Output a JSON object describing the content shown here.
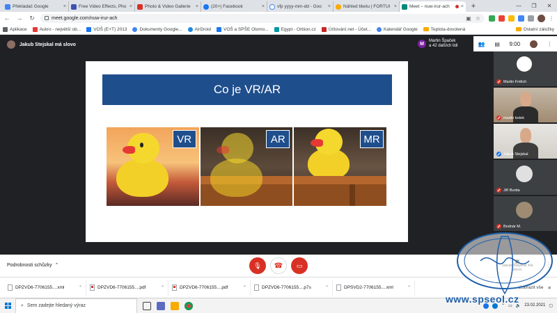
{
  "browser": {
    "tabs": [
      {
        "title": "Překladač Google",
        "color": "#4285f4"
      },
      {
        "title": "Free Video Effects, Pho",
        "color": "#3f51b5"
      },
      {
        "title": "Photo & Video Gallerie",
        "color": "#d93025"
      },
      {
        "title": "(20+) Facebook",
        "color": "#1877f2"
      },
      {
        "title": "vfp yyyy-mm-dd - Goo",
        "color": "#4285f4"
      },
      {
        "title": "Náhled tiketu | FORTUI",
        "color": "#f9ab00"
      },
      {
        "title": "Meet – nuw-irur-ach",
        "color": "#00897b",
        "active": true
      }
    ],
    "new_tab": "+",
    "url": "meet.google.com/nuw-irur-ach",
    "bookmarks": [
      {
        "label": "Aplikace",
        "color": "#5f6368"
      },
      {
        "label": "Aukro - největší ob...",
        "color": "#e53935"
      },
      {
        "label": "VOŠ (E+T) 2013",
        "color": "#1877f2"
      },
      {
        "label": "Dokumenty Google...",
        "color": "#4285f4"
      },
      {
        "label": "AirDroid",
        "color": "#1e88e5"
      },
      {
        "label": "VOŠ a SPŠE Olomo...",
        "color": "#1877f2"
      },
      {
        "label": "Egypt - Orbion.cz",
        "color": "#0097a7"
      },
      {
        "label": "Účtování.net - Účet...",
        "color": "#c62828"
      },
      {
        "label": "Kalendář Google",
        "color": "#4285f4"
      },
      {
        "label": "Teplota-dovolená",
        "color": "#f9ab00"
      }
    ],
    "other_bookmarks": "Ostatní záložky"
  },
  "meet": {
    "presenter_label": "Jakub Stejskal má slovo",
    "participant_summary": {
      "initial": "M",
      "line1": "Martin Špaček",
      "line2": "a 42 dalších lidí"
    },
    "clock": "9:00",
    "slide": {
      "title": "Co je VR/AR",
      "panels": [
        {
          "badge": "VR"
        },
        {
          "badge": "AR"
        },
        {
          "badge": "MR"
        }
      ]
    },
    "participants": [
      {
        "name": "Martin Frélich",
        "type": "logo",
        "color": "#ffffff"
      },
      {
        "name": "martin kotek",
        "type": "camera"
      },
      {
        "name": "Jakub Stejskal",
        "type": "camera"
      },
      {
        "name": "Jiří Burda",
        "type": "avatar",
        "color": "#e0e0e0"
      },
      {
        "name": "Bodnár M.",
        "type": "avatar",
        "color": "#9e8b72"
      }
    ],
    "bottom": {
      "details": "Podrobnosti schůzky",
      "present_label": "Jakub Stejskal má slovo"
    }
  },
  "downloads": {
    "items": [
      {
        "name": "DPZVD6-7706155....xml",
        "kind": "xml"
      },
      {
        "name": "DPZVD6-7706155....pdf",
        "kind": "pdf"
      },
      {
        "name": "DPZVD6-7706155....pdf",
        "kind": "pdf"
      },
      {
        "name": "DPZVD6-7706155....p7s",
        "kind": "p7s"
      },
      {
        "name": "DPSVD2-7706155....xml",
        "kind": "xml"
      }
    ],
    "show_all": "Zobrazit vše"
  },
  "taskbar": {
    "search_placeholder": "Sem zadejte hledaný výraz",
    "date": "23.02.2021"
  },
  "watermark": "www.spseol.cz"
}
